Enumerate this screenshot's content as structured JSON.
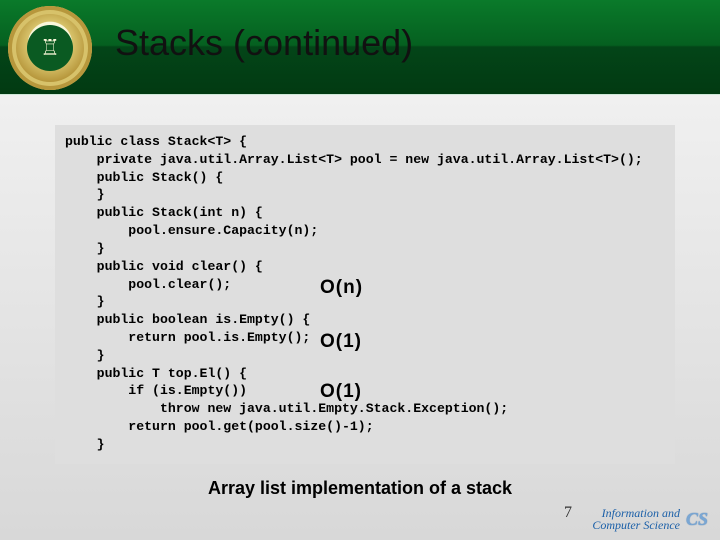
{
  "header": {
    "title": "Stacks (continued)"
  },
  "code": {
    "l1": "public class Stack<T> {",
    "l2": "    private java.util.Array.List<T> pool = new java.util.Array.List<T>();",
    "l3": "    public Stack() {",
    "l4": "    }",
    "l5": "    public Stack(int n) {",
    "l6": "        pool.ensure.Capacity(n);",
    "l7": "    }",
    "l8": "    public void clear() {",
    "l9": "        pool.clear();",
    "l10": "    }",
    "l11": "    public boolean is.Empty() {",
    "l12": "        return pool.is.Empty();",
    "l13": "    }",
    "l14": "    public T top.El() {",
    "l15": "        if (is.Empty())",
    "l16": "            throw new java.util.Empty.Stack.Exception();",
    "l17": "        return pool.get(pool.size()-1);",
    "l18": "    }"
  },
  "annotations": {
    "clear": "O(n)",
    "isEmpty": "O(1)",
    "topEl": "O(1)"
  },
  "caption": "Array list implementation of a stack",
  "footer": {
    "line1": "Information and",
    "line2": "Computer Science",
    "badge": "CS",
    "page": "7"
  }
}
